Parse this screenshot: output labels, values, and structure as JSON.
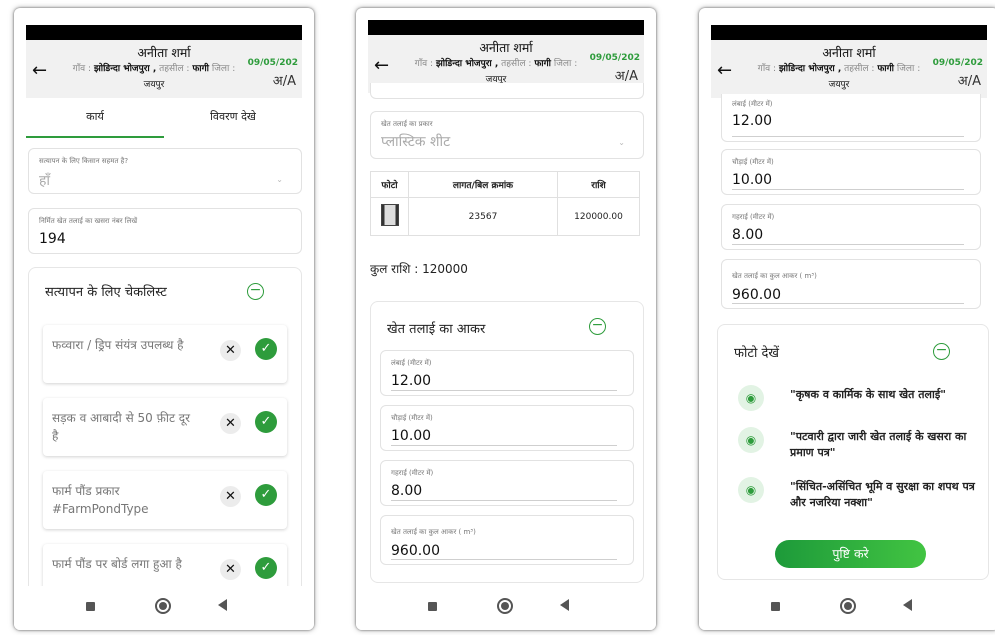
{
  "header": {
    "name": "अनीता शर्मा",
    "village_label": "गाँव :",
    "village": "झोडिन्दा भोजपुरा ,",
    "tehsil_label": "तहसील :",
    "tehsil": "फागी",
    "district_label": "जिला :",
    "district": "जयपुर",
    "date": "09/05/202",
    "lang": "अ/A"
  },
  "screen1": {
    "tabs": [
      "कार्य",
      "विवरण देखे"
    ],
    "farmer_ready_label": "सत्यापन के लिए किसान सहमत है?",
    "farmer_ready_value": "हाँ",
    "khasra_label": "निर्मित खेत तलाई का खसरा नंबर लिखें",
    "khasra_value": "194",
    "checklist_title": "सत्यापन के लिए चेकलिस्ट",
    "checklist": [
      "फव्वारा / ड्रिप संयंत्र उपलब्ध है",
      "सड़क व आबादी से 50 फ़ीट दूर है",
      "फार्म पौंड प्रकार #FarmPondType",
      "फार्म पौंड पर बोर्ड लगा हुआ है"
    ]
  },
  "screen2": {
    "pond_type_label": "खेत तलाई का प्रकार",
    "pond_type_value": "प्लास्टिक शीट",
    "table_headers": [
      "फोटो",
      "लागत/बिल क्रमांक",
      "राशि"
    ],
    "table_rows": [
      {
        "bill_no": "23567",
        "amount": "120000.00"
      }
    ],
    "total": "कुल राशि : 120000",
    "size_card_title": "खेत तलाई का आकर"
  },
  "dimensions": {
    "length_label": "लंबाई (मीटर में)",
    "length_value": "12.00",
    "width_label": "चौड़ाई (मीटर में)",
    "width_value": "10.00",
    "depth_label": "गहराई (मीटर में)",
    "depth_value": "8.00",
    "volume_label": "खेत तलाई का कुल आकर ( m³)",
    "volume_value": "960.00"
  },
  "screen3": {
    "photos_title": "फोटो देखें",
    "photos": [
      "\"कृषक व कार्मिक के साथ खेत तलाई\"",
      "\"पटवारी द्वारा जारी खेत तलाई के खसरा का प्रमाण पत्र\"",
      "\"सिंचित-असिंचित भूमि व सुरक्षा का शपथ पत्र और नजरिया नक्शा\""
    ],
    "confirm_button": "पुष्टि करे"
  },
  "colors": {
    "accent": "#2e9c3c",
    "header_bg": "#f1f1f1"
  },
  "icons": [
    "back-arrow-icon",
    "minus-circle-icon",
    "close-icon",
    "check-icon",
    "eye-icon",
    "chevron-down-icon"
  ]
}
